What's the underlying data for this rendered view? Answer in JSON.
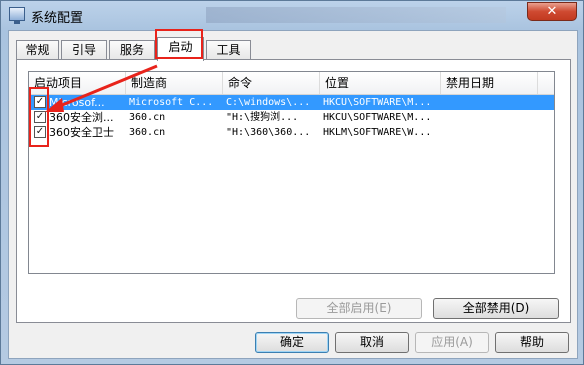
{
  "window": {
    "title": "系统配置",
    "close_glyph": "✕"
  },
  "tabs": [
    {
      "label": "常规",
      "active": false
    },
    {
      "label": "引导",
      "active": false
    },
    {
      "label": "服务",
      "active": false
    },
    {
      "label": "启动",
      "active": true
    },
    {
      "label": "工具",
      "active": false
    }
  ],
  "table": {
    "columns": [
      "启动项目",
      "制造商",
      "命令",
      "位置",
      "禁用日期"
    ],
    "rows": [
      {
        "checked": true,
        "selected": true,
        "name": "Microsof...",
        "maker": "Microsoft C...",
        "command": "C:\\windows\\...",
        "location": "HKCU\\SOFTWARE\\M...",
        "date": ""
      },
      {
        "checked": true,
        "selected": false,
        "name": "360安全浏...",
        "maker": "360.cn",
        "command": "\"H:\\搜狗浏...",
        "location": "HKCU\\SOFTWARE\\M...",
        "date": ""
      },
      {
        "checked": true,
        "selected": false,
        "name": "360安全卫士",
        "maker": "360.cn",
        "command": "\"H:\\360\\360...",
        "location": "HKLM\\SOFTWARE\\W...",
        "date": ""
      }
    ]
  },
  "buttons": {
    "enable_all": "全部启用(E)",
    "disable_all": "全部禁用(D)",
    "ok": "确定",
    "cancel": "取消",
    "apply": "应用(A)",
    "help": "帮助"
  },
  "colors": {
    "selection": "#3399ff",
    "annotation": "#e8231b"
  },
  "icons": {
    "app": "system-config-icon",
    "check": "✓"
  }
}
